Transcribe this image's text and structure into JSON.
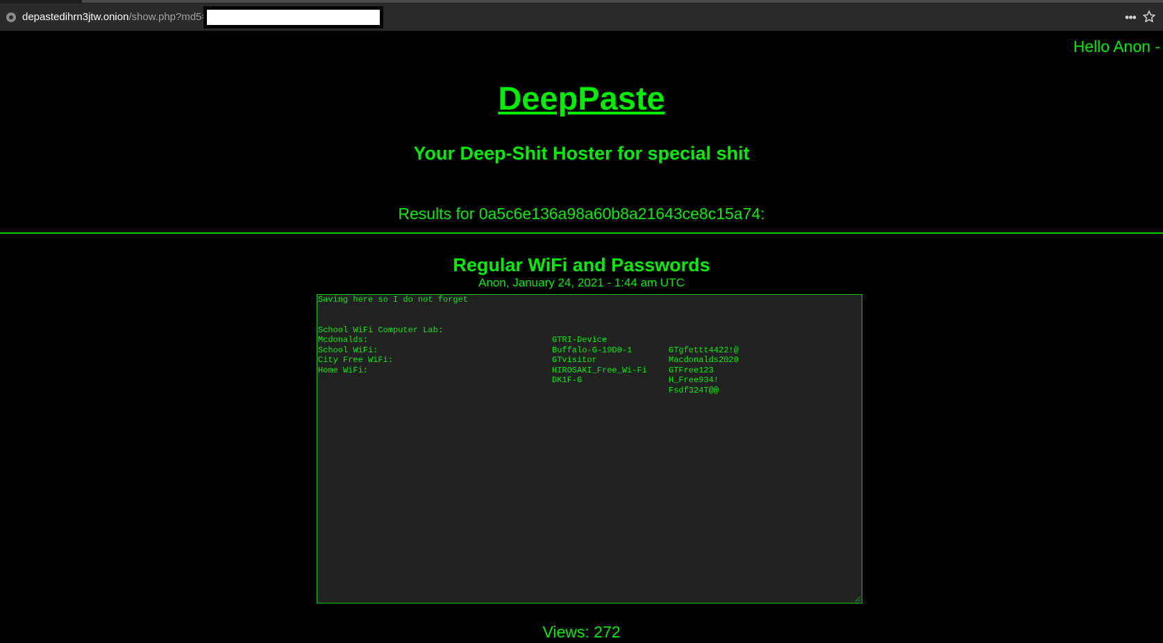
{
  "browser": {
    "url_host": "depastedihrn3jtw.onion",
    "url_path": "/show.php?md5="
  },
  "header": {
    "greeting": "Hello Anon -",
    "site_title": "DeepPaste",
    "tagline": "Your Deep-Shit Hoster for special shit"
  },
  "results": {
    "label": "Results for 0a5c6e136a98a60b8a21643ce8c15a74:"
  },
  "paste": {
    "title": "Regular WiFi and Passwords",
    "meta": "Anon, January 24, 2021 - 1:44 am UTC",
    "intro": "Saving here so I do not forget",
    "rows": [
      [
        "School WiFi Computer Lab:",
        "GTRI-Device",
        "GTgfettt4422!@"
      ],
      [
        "Mcdonalds:",
        "Buffalo-G-19D0-1",
        "Macdonalds2020"
      ],
      [
        "School WiFi:",
        "GTvisitor",
        "GTFree123"
      ],
      [
        "City Free WiFi:",
        "HIROSAKI_Free_Wi-Fi",
        "H_Free934!"
      ],
      [
        "Home WiFi:",
        "DK1F-G",
        "Fsdf324T@@"
      ]
    ]
  },
  "footer": {
    "views": "Views: 272"
  }
}
